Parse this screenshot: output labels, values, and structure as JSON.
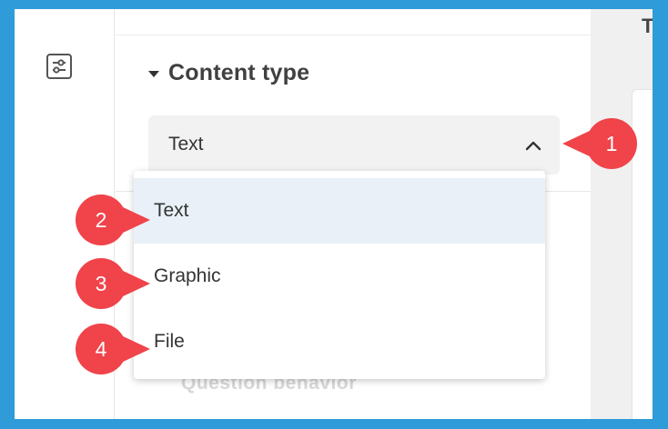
{
  "section": {
    "title": "Content type"
  },
  "select": {
    "value": "Text"
  },
  "menu": {
    "items": [
      {
        "label": "Text",
        "selected": true
      },
      {
        "label": "Graphic",
        "selected": false
      },
      {
        "label": "File",
        "selected": false
      }
    ]
  },
  "faded_label": "Question behavior",
  "right_pane_glyph": "T",
  "callouts": [
    {
      "number": "1",
      "points": "left"
    },
    {
      "number": "2",
      "points": "right"
    },
    {
      "number": "3",
      "points": "right"
    },
    {
      "number": "4",
      "points": "right"
    }
  ],
  "colors": {
    "frame_border": "#2f9bd8",
    "callout_red": "#f0434a",
    "selected_bg": "#e9f0f8",
    "select_bg": "#f2f2f2"
  }
}
